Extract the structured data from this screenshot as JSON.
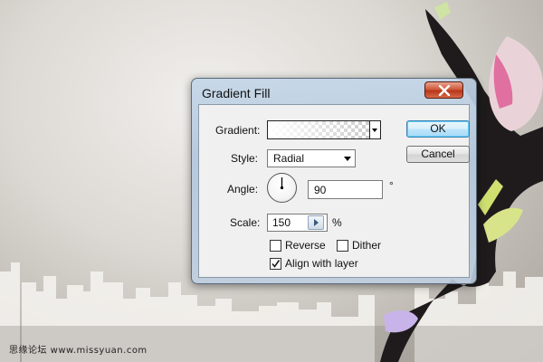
{
  "watermark": "思缘论坛 www.missyuan.com",
  "dialog": {
    "title": "Gradient Fill",
    "close_icon": "close-x-icon",
    "gradient": {
      "label": "Gradient:",
      "dropdown_icon": "chevron-down-icon"
    },
    "style": {
      "label": "Style:",
      "value": "Radial",
      "dropdown_icon": "chevron-down-icon"
    },
    "angle": {
      "label": "Angle:",
      "value": "90",
      "unit": "°",
      "dial_icon": "angle-dial-icon"
    },
    "scale": {
      "label": "Scale:",
      "value": "150",
      "unit": "%",
      "stepper_icon": "chevron-right-icon"
    },
    "options": [
      {
        "label": "Reverse",
        "checked": false
      },
      {
        "label": "Dither",
        "checked": false
      },
      {
        "label": "Align with layer",
        "checked": true
      }
    ],
    "buttons": {
      "ok": "OK",
      "cancel": "Cancel"
    }
  },
  "colors": {
    "close_button": "#c8452a",
    "ok_button_border": "#3c7fb1",
    "dialog_frame": "#b8cbe0"
  }
}
